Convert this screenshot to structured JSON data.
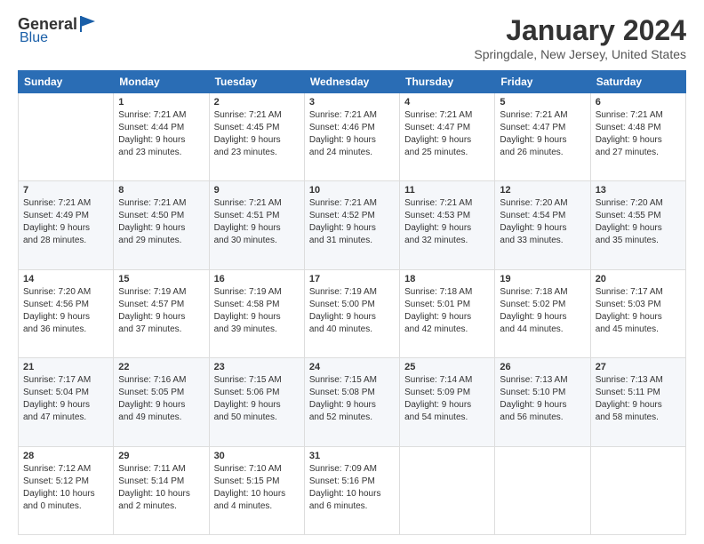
{
  "header": {
    "logo_general": "General",
    "logo_blue": "Blue",
    "month_title": "January 2024",
    "location": "Springdale, New Jersey, United States"
  },
  "days_of_week": [
    "Sunday",
    "Monday",
    "Tuesday",
    "Wednesday",
    "Thursday",
    "Friday",
    "Saturday"
  ],
  "weeks": [
    [
      {
        "day": "",
        "info": ""
      },
      {
        "day": "1",
        "info": "Sunrise: 7:21 AM\nSunset: 4:44 PM\nDaylight: 9 hours\nand 23 minutes."
      },
      {
        "day": "2",
        "info": "Sunrise: 7:21 AM\nSunset: 4:45 PM\nDaylight: 9 hours\nand 23 minutes."
      },
      {
        "day": "3",
        "info": "Sunrise: 7:21 AM\nSunset: 4:46 PM\nDaylight: 9 hours\nand 24 minutes."
      },
      {
        "day": "4",
        "info": "Sunrise: 7:21 AM\nSunset: 4:47 PM\nDaylight: 9 hours\nand 25 minutes."
      },
      {
        "day": "5",
        "info": "Sunrise: 7:21 AM\nSunset: 4:47 PM\nDaylight: 9 hours\nand 26 minutes."
      },
      {
        "day": "6",
        "info": "Sunrise: 7:21 AM\nSunset: 4:48 PM\nDaylight: 9 hours\nand 27 minutes."
      }
    ],
    [
      {
        "day": "7",
        "info": "Sunrise: 7:21 AM\nSunset: 4:49 PM\nDaylight: 9 hours\nand 28 minutes."
      },
      {
        "day": "8",
        "info": "Sunrise: 7:21 AM\nSunset: 4:50 PM\nDaylight: 9 hours\nand 29 minutes."
      },
      {
        "day": "9",
        "info": "Sunrise: 7:21 AM\nSunset: 4:51 PM\nDaylight: 9 hours\nand 30 minutes."
      },
      {
        "day": "10",
        "info": "Sunrise: 7:21 AM\nSunset: 4:52 PM\nDaylight: 9 hours\nand 31 minutes."
      },
      {
        "day": "11",
        "info": "Sunrise: 7:21 AM\nSunset: 4:53 PM\nDaylight: 9 hours\nand 32 minutes."
      },
      {
        "day": "12",
        "info": "Sunrise: 7:20 AM\nSunset: 4:54 PM\nDaylight: 9 hours\nand 33 minutes."
      },
      {
        "day": "13",
        "info": "Sunrise: 7:20 AM\nSunset: 4:55 PM\nDaylight: 9 hours\nand 35 minutes."
      }
    ],
    [
      {
        "day": "14",
        "info": "Sunrise: 7:20 AM\nSunset: 4:56 PM\nDaylight: 9 hours\nand 36 minutes."
      },
      {
        "day": "15",
        "info": "Sunrise: 7:19 AM\nSunset: 4:57 PM\nDaylight: 9 hours\nand 37 minutes."
      },
      {
        "day": "16",
        "info": "Sunrise: 7:19 AM\nSunset: 4:58 PM\nDaylight: 9 hours\nand 39 minutes."
      },
      {
        "day": "17",
        "info": "Sunrise: 7:19 AM\nSunset: 5:00 PM\nDaylight: 9 hours\nand 40 minutes."
      },
      {
        "day": "18",
        "info": "Sunrise: 7:18 AM\nSunset: 5:01 PM\nDaylight: 9 hours\nand 42 minutes."
      },
      {
        "day": "19",
        "info": "Sunrise: 7:18 AM\nSunset: 5:02 PM\nDaylight: 9 hours\nand 44 minutes."
      },
      {
        "day": "20",
        "info": "Sunrise: 7:17 AM\nSunset: 5:03 PM\nDaylight: 9 hours\nand 45 minutes."
      }
    ],
    [
      {
        "day": "21",
        "info": "Sunrise: 7:17 AM\nSunset: 5:04 PM\nDaylight: 9 hours\nand 47 minutes."
      },
      {
        "day": "22",
        "info": "Sunrise: 7:16 AM\nSunset: 5:05 PM\nDaylight: 9 hours\nand 49 minutes."
      },
      {
        "day": "23",
        "info": "Sunrise: 7:15 AM\nSunset: 5:06 PM\nDaylight: 9 hours\nand 50 minutes."
      },
      {
        "day": "24",
        "info": "Sunrise: 7:15 AM\nSunset: 5:08 PM\nDaylight: 9 hours\nand 52 minutes."
      },
      {
        "day": "25",
        "info": "Sunrise: 7:14 AM\nSunset: 5:09 PM\nDaylight: 9 hours\nand 54 minutes."
      },
      {
        "day": "26",
        "info": "Sunrise: 7:13 AM\nSunset: 5:10 PM\nDaylight: 9 hours\nand 56 minutes."
      },
      {
        "day": "27",
        "info": "Sunrise: 7:13 AM\nSunset: 5:11 PM\nDaylight: 9 hours\nand 58 minutes."
      }
    ],
    [
      {
        "day": "28",
        "info": "Sunrise: 7:12 AM\nSunset: 5:12 PM\nDaylight: 10 hours\nand 0 minutes."
      },
      {
        "day": "29",
        "info": "Sunrise: 7:11 AM\nSunset: 5:14 PM\nDaylight: 10 hours\nand 2 minutes."
      },
      {
        "day": "30",
        "info": "Sunrise: 7:10 AM\nSunset: 5:15 PM\nDaylight: 10 hours\nand 4 minutes."
      },
      {
        "day": "31",
        "info": "Sunrise: 7:09 AM\nSunset: 5:16 PM\nDaylight: 10 hours\nand 6 minutes."
      },
      {
        "day": "",
        "info": ""
      },
      {
        "day": "",
        "info": ""
      },
      {
        "day": "",
        "info": ""
      }
    ]
  ]
}
